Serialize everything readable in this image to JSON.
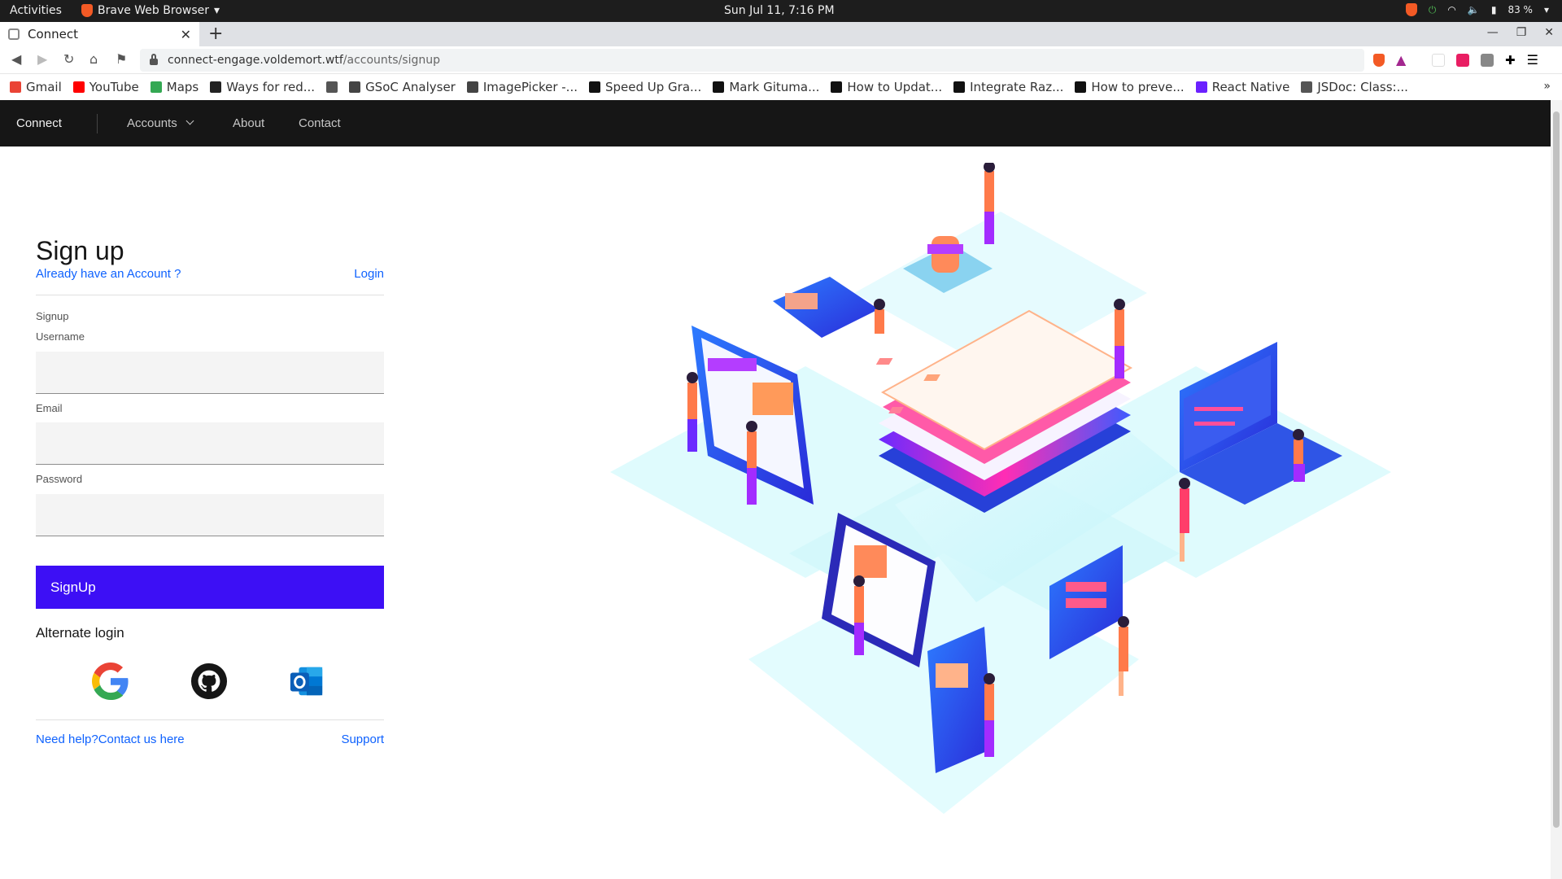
{
  "os_bar": {
    "activities": "Activities",
    "app_name": "Brave Web Browser",
    "clock": "Sun Jul 11,  7:16 PM",
    "battery": "83 %"
  },
  "browser": {
    "tab_title": "Connect",
    "url_host": "connect-engage.voldemort.wtf",
    "url_path": "/accounts/signup"
  },
  "bookmarks": [
    {
      "label": "Gmail",
      "color": "#ea4335"
    },
    {
      "label": "YouTube",
      "color": "#ff0000"
    },
    {
      "label": "Maps",
      "color": "#34a853"
    },
    {
      "label": "Ways for red...",
      "color": "#222222"
    },
    {
      "label": "",
      "color": "#555555"
    },
    {
      "label": "GSoC Analyser",
      "color": "#444444"
    },
    {
      "label": "ImagePicker -...",
      "color": "#444444"
    },
    {
      "label": "Speed Up Gra...",
      "color": "#111111"
    },
    {
      "label": "Mark Gituma...",
      "color": "#111111"
    },
    {
      "label": "How to Updat...",
      "color": "#111111"
    },
    {
      "label": "Integrate Raz...",
      "color": "#111111"
    },
    {
      "label": "How to preve...",
      "color": "#111111"
    },
    {
      "label": "React Native",
      "color": "#6b21ff"
    },
    {
      "label": "JSDoc: Class:...",
      "color": "#555555"
    }
  ],
  "nav": {
    "brand": "Connect",
    "accounts": "Accounts",
    "about": "About",
    "contact": "Contact"
  },
  "form": {
    "title": "Sign up",
    "have_account": "Already have an Account ?",
    "login": "Login",
    "legend": "Signup",
    "username_label": "Username",
    "email_label": "Email",
    "password_label": "Password",
    "submit": "SignUp",
    "alternate": "Alternate login",
    "help": "Need help?Contact us here",
    "support": "Support"
  },
  "colors": {
    "primary_button": "#3d0ff5",
    "link": "#0f62fe",
    "navbar": "#161616"
  }
}
